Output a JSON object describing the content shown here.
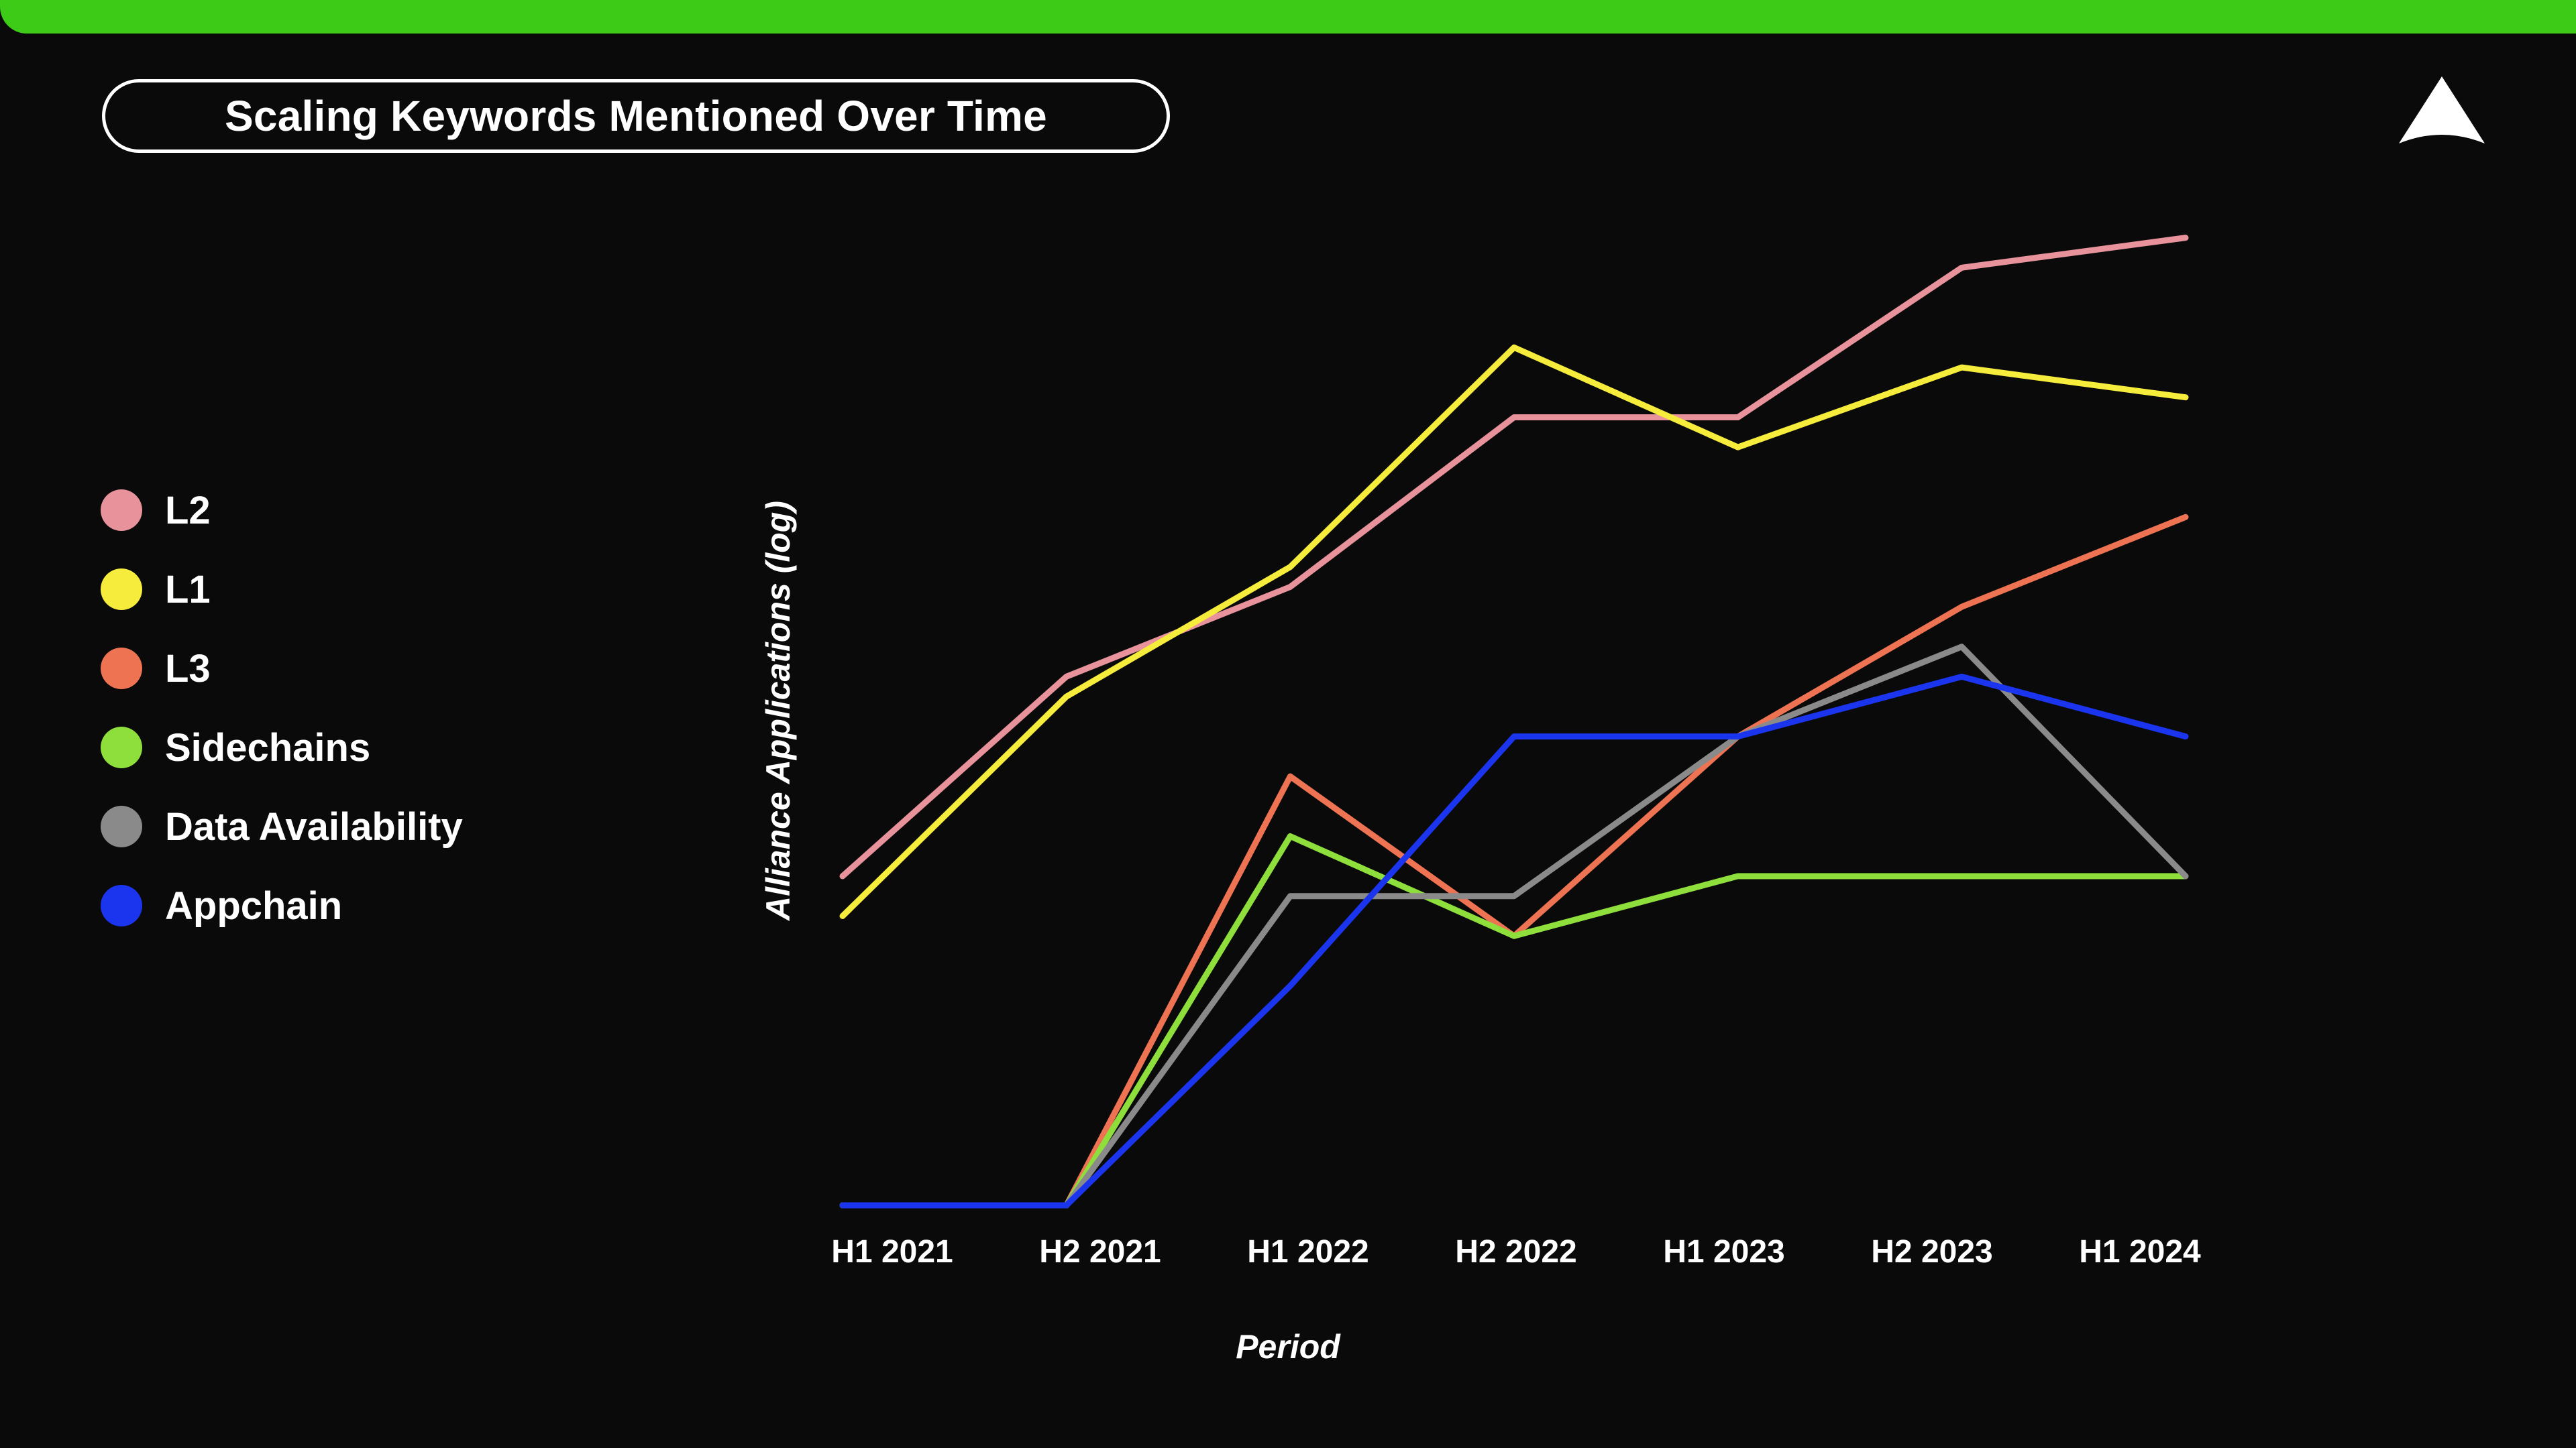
{
  "header": {
    "accent_color": "#3dcb17",
    "title": "Scaling Keywords Mentioned Over Time",
    "logo_name": "alliance-logo"
  },
  "legend": {
    "items": [
      {
        "label": "L2",
        "color": "#e8929c"
      },
      {
        "label": "L1",
        "color": "#f5ec3c"
      },
      {
        "label": "L3",
        "color": "#ee7352"
      },
      {
        "label": "Sidechains",
        "color": "#8ede3c"
      },
      {
        "label": "Data Availability",
        "color": "#8a8a8a"
      },
      {
        "label": "Appchain",
        "color": "#1b35ef"
      }
    ]
  },
  "chart_data": {
    "type": "line",
    "title": "Scaling Keywords Mentioned Over Time",
    "xlabel": "Period",
    "ylabel": "Alliance Applications (log)",
    "categories": [
      "H1 2021",
      "H2 2021",
      "H1 2022",
      "H2 2022",
      "H1 2023",
      "H2 2023",
      "H1 2024"
    ],
    "ylim": [
      0,
      100
    ],
    "yscale": "log",
    "grid": false,
    "legend_position": "left",
    "series": [
      {
        "name": "L2",
        "color": "#e8929c",
        "values": [
          33,
          53,
          62,
          79,
          79,
          94,
          97
        ]
      },
      {
        "name": "L1",
        "color": "#f5ec3c",
        "values": [
          29,
          51,
          64,
          86,
          76,
          84,
          81
        ]
      },
      {
        "name": "L3",
        "color": "#ee7352",
        "values": [
          0,
          0,
          43,
          27,
          47,
          60,
          69
        ]
      },
      {
        "name": "Sidechains",
        "color": "#8ede3c",
        "values": [
          0,
          0,
          37,
          27,
          33,
          33,
          33
        ]
      },
      {
        "name": "Data Availability",
        "color": "#8a8a8a",
        "values": [
          0,
          0,
          31,
          31,
          47,
          56,
          33
        ]
      },
      {
        "name": "Appchain",
        "color": "#1b35ef",
        "values": [
          0,
          0,
          22,
          47,
          47,
          53,
          47
        ]
      }
    ]
  },
  "axes": {
    "x_ticks": [
      "H1 2021",
      "H2 2021",
      "H1 2022",
      "H2 2022",
      "H1 2023",
      "H2 2023",
      "H1 2024"
    ],
    "x_title": "Period",
    "y_title": "Alliance Applications (log)"
  }
}
